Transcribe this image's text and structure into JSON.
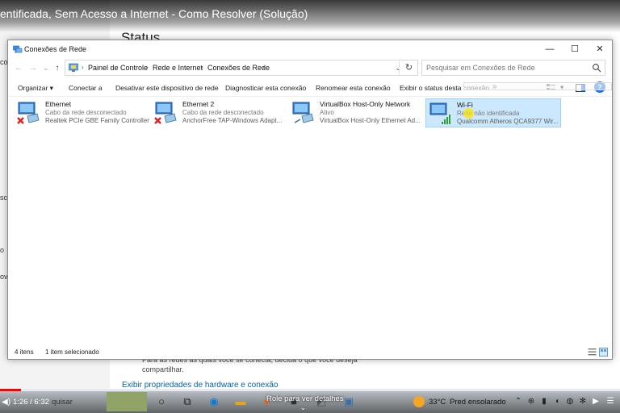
{
  "video": {
    "title": "entificada, Sem Acesso a Internet - Como Resolver (Solução)",
    "time": "1:26 / 6:32",
    "scroll_hint": "Role para ver detalhes",
    "progress_fraction": 0.034
  },
  "background": {
    "page_heading": "Status",
    "left_fragments": [
      "co",
      "sc",
      "o",
      "ove"
    ],
    "body_text": "Para as redes às quais você se conecta, decida o que você deseja compartilhar.",
    "link": "Exibir propriedades de hardware e conexão"
  },
  "window": {
    "title": "Conexões de Rede",
    "controls": {
      "minimize": "—",
      "maximize": "☐",
      "close": "✕"
    }
  },
  "address": {
    "crumbs": [
      "Painel de Controle",
      "Rede e Internet",
      "Conexões de Rede"
    ],
    "search_placeholder": "Pesquisar em Conexões de Rede"
  },
  "commands": {
    "organize": "Organizar ▾",
    "connect": "Conectar a",
    "disable": "Desativar este dispositivo de rede",
    "diagnose": "Diagnosticar esta conexão",
    "rename": "Renomear esta conexão",
    "status": "Exibir o status desta conexão",
    "more": "»"
  },
  "adapters": [
    {
      "name": "Ethernet",
      "status": "Cabo da rede desconectado",
      "device": "Realtek PCIe GBE Family Controller",
      "state": "disconnected",
      "selected": false
    },
    {
      "name": "Ethernet 2",
      "status": "Cabo da rede desconectado",
      "device": "AnchorFree TAP-Windows Adapt...",
      "state": "disconnected",
      "selected": false
    },
    {
      "name": "VirtualBox Host-Only Network",
      "status": "Ativo",
      "device": "VirtualBox Host-Only Ethernet Ad...",
      "state": "active",
      "selected": false
    },
    {
      "name": "Wi-Fi",
      "status": "Rede não identificada",
      "device": "Qualcomm Atheros QCA9377 Wir...",
      "state": "wifi",
      "selected": true
    }
  ],
  "statusbar": {
    "count": "4 itens",
    "selected": "1 item selecionado"
  },
  "taskbar": {
    "search": "quisar",
    "weather_temp": "33°C",
    "weather_desc": "Pred ensolarado"
  },
  "colors": {
    "selection": "#cce8ff",
    "selection_border": "#99d1ff",
    "accent": "#0063b1",
    "progress": "#ff0000"
  }
}
